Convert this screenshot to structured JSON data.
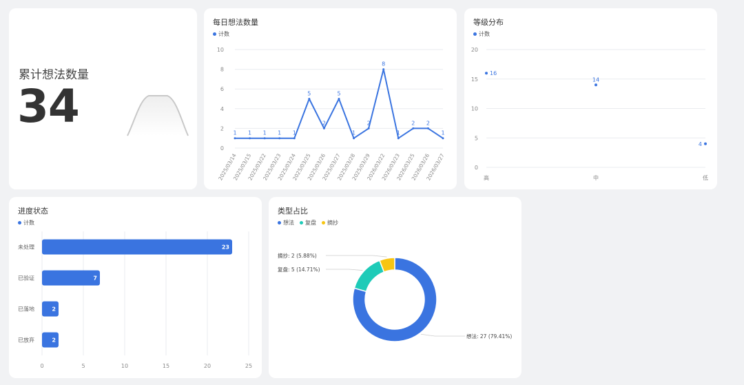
{
  "kpi": {
    "label": "累计想法数量",
    "value": "34"
  },
  "colors": {
    "primary": "#3a74e0",
    "teal": "#1ecbb8",
    "yellow": "#f7c512",
    "grid": "#e9ebef",
    "axis_text": "#888888"
  },
  "chart_data": [
    {
      "id": "daily",
      "type": "line",
      "title": "每日想法数量",
      "legend": [
        "计数"
      ],
      "x": [
        "2025/03/14",
        "2025/03/15",
        "2025/03/22",
        "2025/03/23",
        "2025/03/24",
        "2025/03/25",
        "2025/03/26",
        "2025/03/27",
        "2025/03/28",
        "2025/03/29",
        "2026/03/22",
        "2026/03/23",
        "2026/03/25",
        "2026/03/26",
        "2026/03/27"
      ],
      "series": [
        {
          "name": "计数",
          "values": [
            1,
            1,
            1,
            1,
            1,
            5,
            2,
            5,
            1,
            2,
            8,
            1,
            2,
            2,
            1
          ]
        }
      ],
      "yticks": [
        "0",
        "2",
        "4",
        "6",
        "8",
        "10"
      ],
      "ylim": [
        0,
        10
      ],
      "grid": true
    },
    {
      "id": "level",
      "type": "scatter",
      "title": "等级分布",
      "legend": [
        "计数"
      ],
      "categories": [
        "高",
        "中",
        "低"
      ],
      "series": [
        {
          "name": "计数",
          "values": [
            16,
            14,
            4
          ]
        }
      ],
      "yticks": [
        "0",
        "5",
        "10",
        "15",
        "20"
      ],
      "ylim": [
        0,
        20
      ],
      "grid": true
    },
    {
      "id": "progress",
      "type": "bar",
      "orientation": "horizontal",
      "title": "进度状态",
      "legend": [
        "计数"
      ],
      "categories": [
        "未处理",
        "已验证",
        "已落地",
        "已放弃"
      ],
      "series": [
        {
          "name": "计数",
          "values": [
            23,
            7,
            2,
            2
          ]
        }
      ],
      "xticks": [
        "0",
        "5",
        "10",
        "15",
        "20",
        "25"
      ],
      "xlim": [
        0,
        25
      ],
      "grid": true
    },
    {
      "id": "types",
      "type": "pie",
      "title": "类型占比",
      "legend": [
        "想法",
        "复盘",
        "摘抄"
      ],
      "slices": [
        {
          "label": "想法",
          "value": 27,
          "text": "想法: 27 (79.41%)"
        },
        {
          "label": "复盘",
          "value": 5,
          "text": "复盘: 5 (14.71%)"
        },
        {
          "label": "摘抄",
          "value": 2,
          "text": "摘抄: 2 (5.88%)"
        }
      ]
    }
  ]
}
